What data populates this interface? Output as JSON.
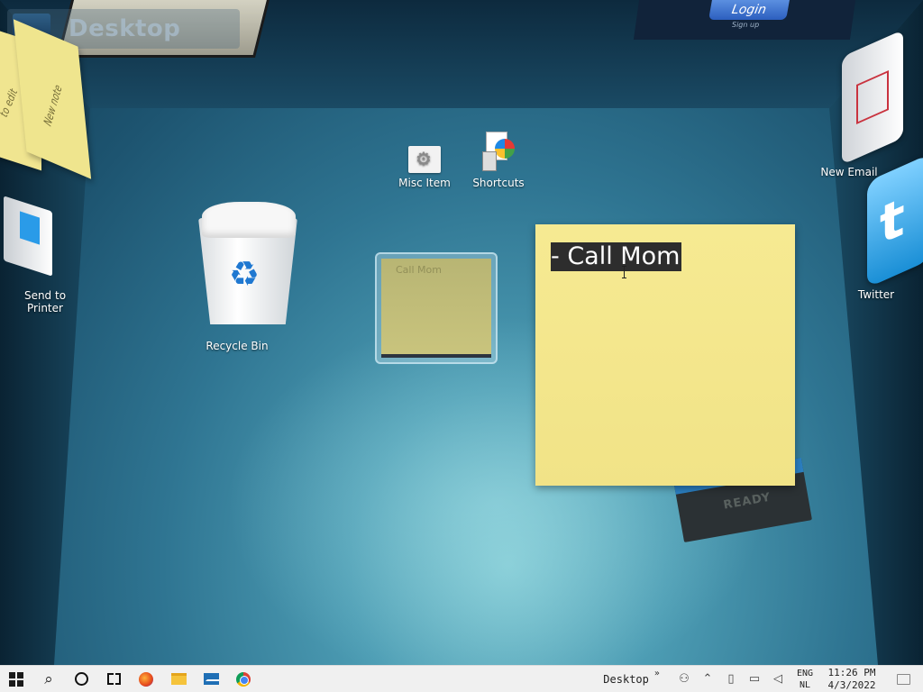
{
  "desktop": {
    "title": "Desktop"
  },
  "account": {
    "login_label": "Login",
    "signup_label": "Sign up"
  },
  "wall_notes": [
    {
      "text": "to edit"
    },
    {
      "text": "New note"
    }
  ],
  "icons": {
    "misc_item": "Misc Item",
    "shortcuts": "Shortcuts",
    "recycle_bin": "Recycle Bin",
    "send_to_printer_line1": "Send to",
    "send_to_printer_line2": "Printer",
    "new_email": "New Email",
    "twitter": "Twitter"
  },
  "mini_note": {
    "text": "Call Mom"
  },
  "sticky_note": {
    "selected_text": "- Call Mom"
  },
  "tray_label": "READY",
  "taskbar": {
    "apps": [
      "start-icon",
      "search-icon",
      "cortana-icon",
      "task-view-icon",
      "firefox-icon",
      "file-explorer-icon",
      "mail-icon",
      "chrome-icon"
    ],
    "toolbar_label": "Desktop",
    "chevron": "»",
    "lang_line1": "ENG",
    "lang_line2": "NL",
    "time": "11:26 PM",
    "date": "4/3/2022"
  }
}
